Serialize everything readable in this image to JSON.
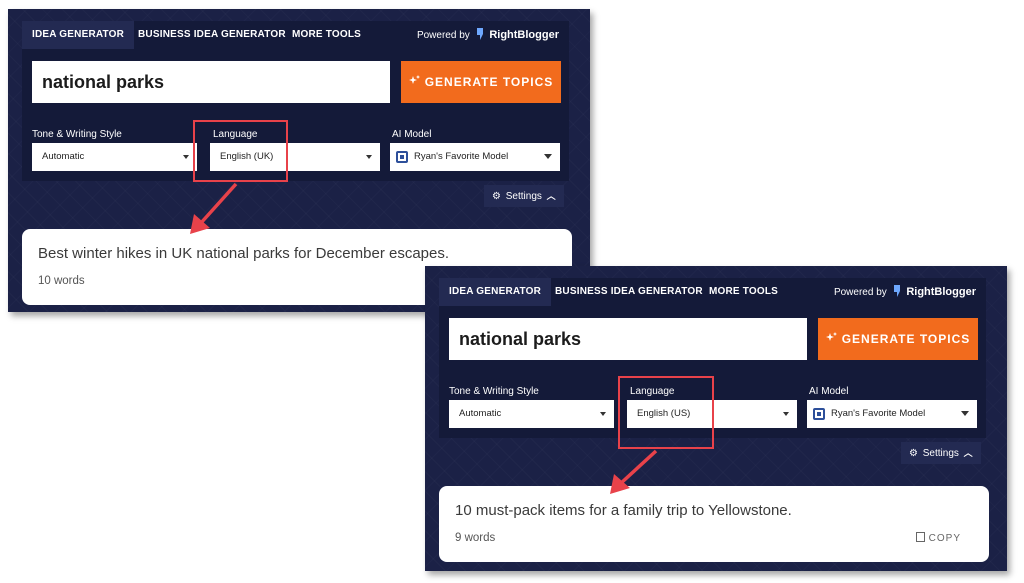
{
  "colors": {
    "panel_bg": "#1b2146",
    "accent": "#f26b1d",
    "highlight": "#e8424a"
  },
  "screens": [
    {
      "tabs": [
        "IDEA GENERATOR",
        "BUSINESS IDEA GENERATOR",
        "MORE TOOLS"
      ],
      "active_tab": "IDEA GENERATOR",
      "powered_by": "Powered by",
      "brand": "RightBlogger",
      "topic_value": "national parks",
      "generate_label": "GENERATE TOPICS",
      "tone_label": "Tone & Writing Style",
      "tone_value": "Automatic",
      "language_label": "Language",
      "language_value": "English (UK)",
      "model_label": "AI Model",
      "model_value": "Ryan's Favorite Model",
      "settings_label": "Settings",
      "result_text": "Best winter hikes in UK national parks for December escapes.",
      "word_count": "10 words"
    },
    {
      "tabs": [
        "IDEA GENERATOR",
        "BUSINESS IDEA GENERATOR",
        "MORE TOOLS"
      ],
      "active_tab": "IDEA GENERATOR",
      "powered_by": "Powered by",
      "brand": "RightBlogger",
      "topic_value": "national parks",
      "generate_label": "GENERATE TOPICS",
      "tone_label": "Tone & Writing Style",
      "tone_value": "Automatic",
      "language_label": "Language",
      "language_value": "English (US)",
      "model_label": "AI Model",
      "model_value": "Ryan's Favorite Model",
      "settings_label": "Settings",
      "result_text": "10 must-pack items for a family trip to Yellowstone.",
      "word_count": "9 words",
      "copy_label": "COPY"
    }
  ]
}
